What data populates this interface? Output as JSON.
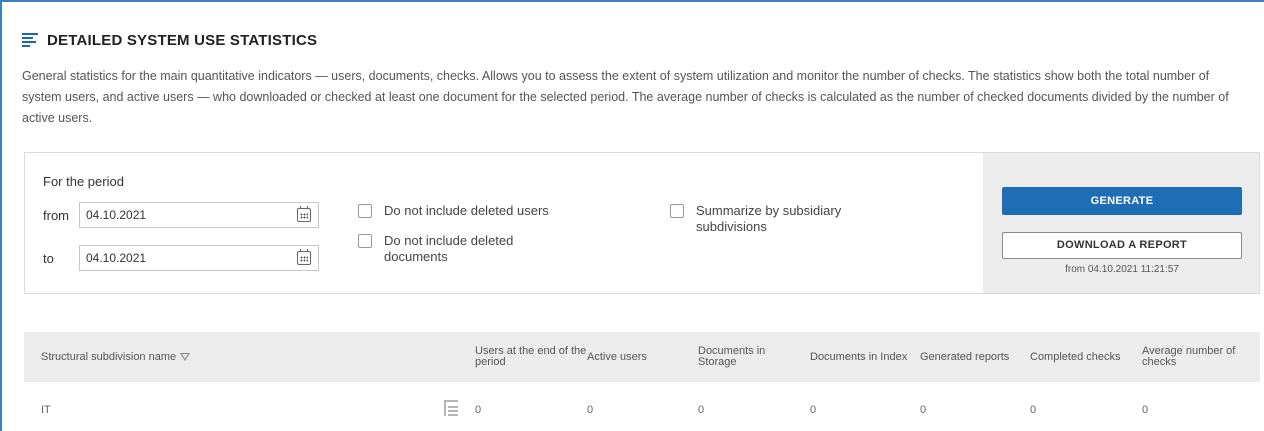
{
  "header": {
    "icon": "bar-list-icon",
    "title": "DETAILED SYSTEM USE STATISTICS",
    "description": "General statistics for the main quantitative indicators — users, documents, checks. Allows you to assess the extent of system utilization and monitor the number of checks. The statistics show both the total number of system users, and active users — who downloaded or checked at least one document for the selected period. The average number of checks is calculated as the number of checked documents divided by the number of active users."
  },
  "filters": {
    "period_label": "For the period",
    "from_label": "from",
    "to_label": "to",
    "from_value": "04.10.2021",
    "to_value": "04.10.2021",
    "options": {
      "exclude_deleted_users": "Do not include deleted users",
      "exclude_deleted_documents": "Do not include deleted documents",
      "summarize_subsidiary": "Summarize by subsidiary subdivisions"
    }
  },
  "actions": {
    "generate_label": "GENERATE",
    "download_label": "DOWNLOAD A REPORT",
    "report_timestamp": "from 04.10.2021 11:21:57",
    "accent_color": "#1e6db5"
  },
  "table": {
    "columns": [
      "Structural subdivision name",
      "Users at the end of the period",
      "Active users",
      "Documents in Storage",
      "Documents in Index",
      "Generated reports",
      "Completed checks",
      "Average number of checks"
    ],
    "rows": [
      {
        "name": "IT",
        "users_end": "0",
        "active_users": "0",
        "docs_storage": "0",
        "docs_index": "0",
        "generated_reports": "0",
        "completed_checks": "0",
        "avg_checks": "0"
      }
    ]
  }
}
